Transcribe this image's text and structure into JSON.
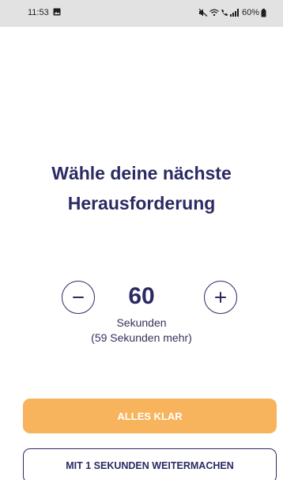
{
  "status_bar": {
    "time": "11:53",
    "battery": "60%",
    "icons": [
      "gallery-icon",
      "mute-icon",
      "wifi-icon",
      "call-icon",
      "signal-icon",
      "battery-icon"
    ]
  },
  "title": {
    "line1": "Wähle deine nächste",
    "line2": "Herausforderung"
  },
  "stepper": {
    "value": "60",
    "unit": "Sekunden",
    "extra": "(59 Sekunden mehr)",
    "minus_icon": "minus-icon",
    "plus_icon": "plus-icon"
  },
  "buttons": {
    "primary_label": "ALLES KLAR",
    "secondary_label": "MIT 1 SEKUNDEN WEITERMACHEN"
  },
  "colors": {
    "primary": "#2b2a63",
    "accent": "#f8b45c",
    "status_bar": "#e2e2e2"
  }
}
